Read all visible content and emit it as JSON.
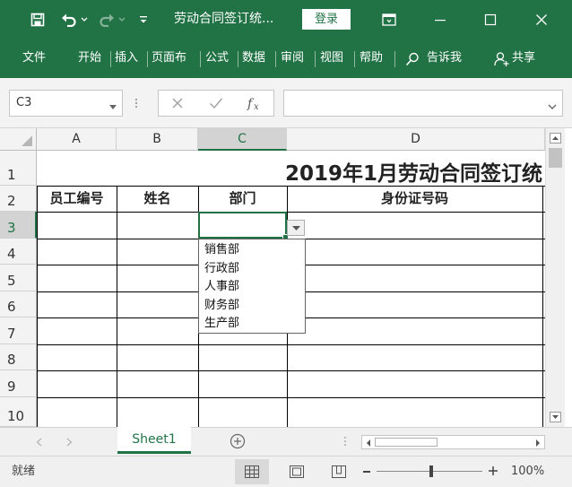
{
  "window": {
    "title": "劳动合同签订统...",
    "login_label": "登录"
  },
  "ribbon": {
    "tabs": [
      "文件",
      "开始",
      "插入",
      "页面布",
      "公式",
      "数据",
      "审阅",
      "视图",
      "帮助"
    ],
    "tell_me": "告诉我",
    "share": "共享"
  },
  "formula_bar": {
    "name_box": "C3",
    "formula": ""
  },
  "sheet": {
    "columns": [
      "A",
      "B",
      "C",
      "D"
    ],
    "rows": [
      "1",
      "2",
      "3",
      "4",
      "5",
      "6",
      "7",
      "8",
      "9",
      "10"
    ],
    "title": "2019年1月劳动合同签订统",
    "headers": [
      "员工编号",
      "姓名",
      "部门",
      "身份证号码"
    ],
    "dropdown_options": [
      "销售部",
      "行政部",
      "人事部",
      "财务部",
      "生产部"
    ]
  },
  "sheet_tabs": {
    "active": "Sheet1"
  },
  "status_bar": {
    "status": "就绪",
    "zoom": "100%"
  },
  "colors": {
    "accent": "#217346"
  }
}
